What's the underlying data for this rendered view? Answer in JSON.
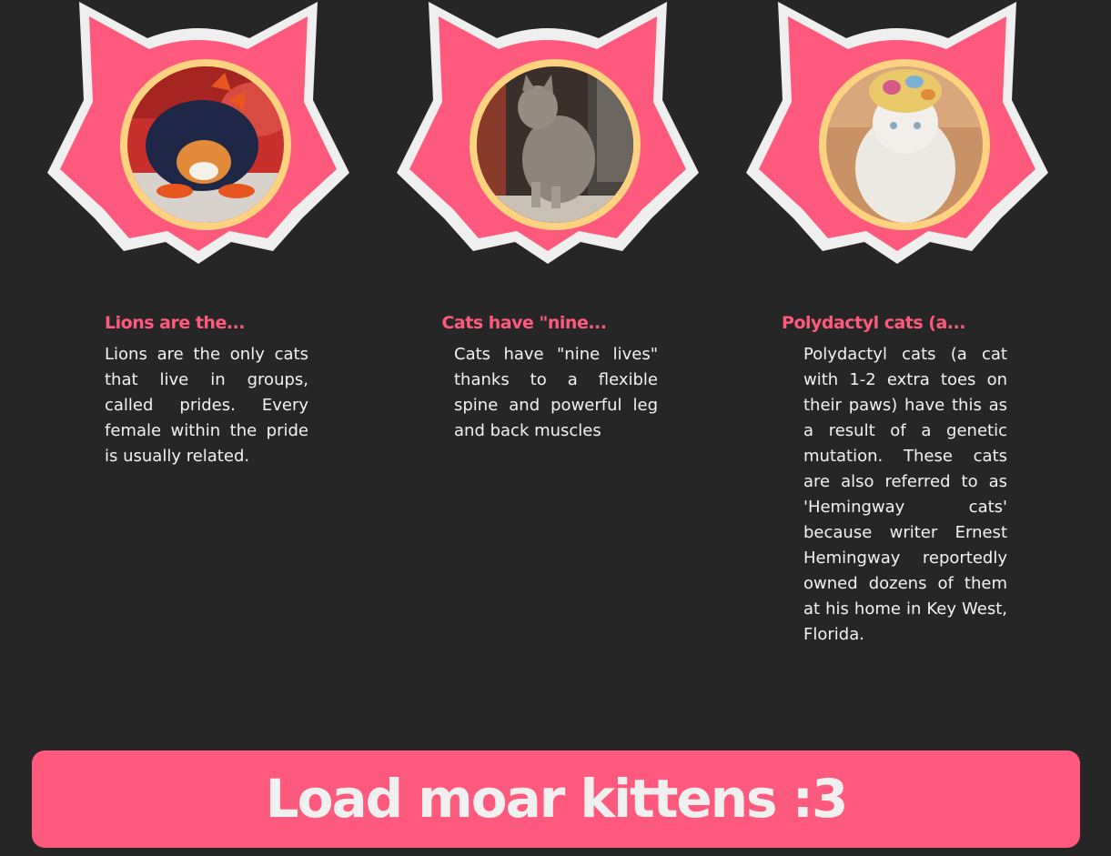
{
  "cards": [
    {
      "title": "Lions are the...",
      "text": "Lions are the only cats that live in groups, called prides. Every female within the pride is usually related.",
      "photo": "cat-in-dinosaur-hoodie"
    },
    {
      "title": "Cats have \"nine...",
      "text": "Cats have \"nine lives\" thanks to a flexible spine and powerful leg and back muscles",
      "photo": "tabby-cat-sitting"
    },
    {
      "title": "Polydactyl cats (a...",
      "text": "Polydactyl cats (a cat with 1-2 extra toes on their paws) have this as a result of a genetic mutation. These cats are also referred to as 'Hemingway cats' because writer Ernest Hemingway reportedly owned dozens of them at his home in Key West, Florida.",
      "photo": "white-cat-with-knit-hat"
    }
  ],
  "load_button": {
    "label": "Load moar kittens :3"
  },
  "colors": {
    "background": "#262626",
    "accent": "#ff5a7e",
    "badge_outline": "#efefef",
    "photo_ring": "#ffd27f",
    "text": "#f2f2f2"
  }
}
